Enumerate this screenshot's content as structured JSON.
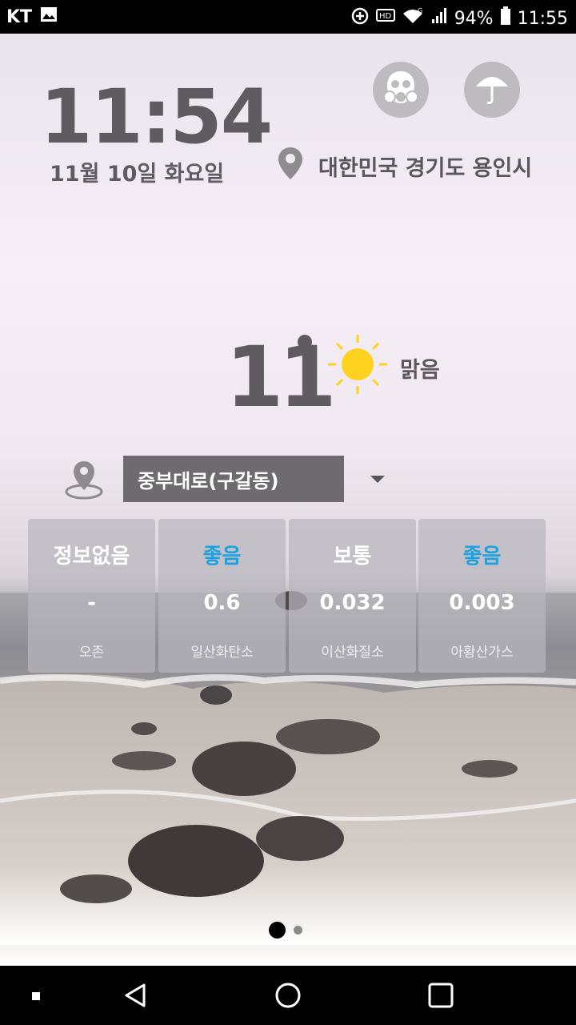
{
  "status_bar": {
    "carrier": "KT",
    "battery": "94%",
    "time": "11:55"
  },
  "clock": {
    "time": "11:54",
    "date": "11월 10일 화요일"
  },
  "location": {
    "label": "대한민국 경기도 용인시"
  },
  "weather": {
    "temperature": "11",
    "condition": "맑음"
  },
  "station": {
    "selected": "중부대로(구갈동)"
  },
  "air_quality": [
    {
      "grade": "정보없음",
      "value": "-",
      "name": "오존",
      "grade_color": "#ffffff"
    },
    {
      "grade": "좋음",
      "value": "0.6",
      "name": "일산화탄소",
      "grade_color": "#1aa3e0"
    },
    {
      "grade": "보통",
      "value": "0.032",
      "name": "이산화질소",
      "grade_color": "#ffffff"
    },
    {
      "grade": "좋음",
      "value": "0.003",
      "name": "아황산가스",
      "grade_color": "#1aa3e0"
    }
  ],
  "pager": {
    "pages": 2,
    "current": 1
  },
  "icons": {
    "gas_mask": "gas-mask-icon",
    "umbrella": "umbrella-icon",
    "location_pin": "location-pin-icon",
    "sun": "sun-icon"
  }
}
